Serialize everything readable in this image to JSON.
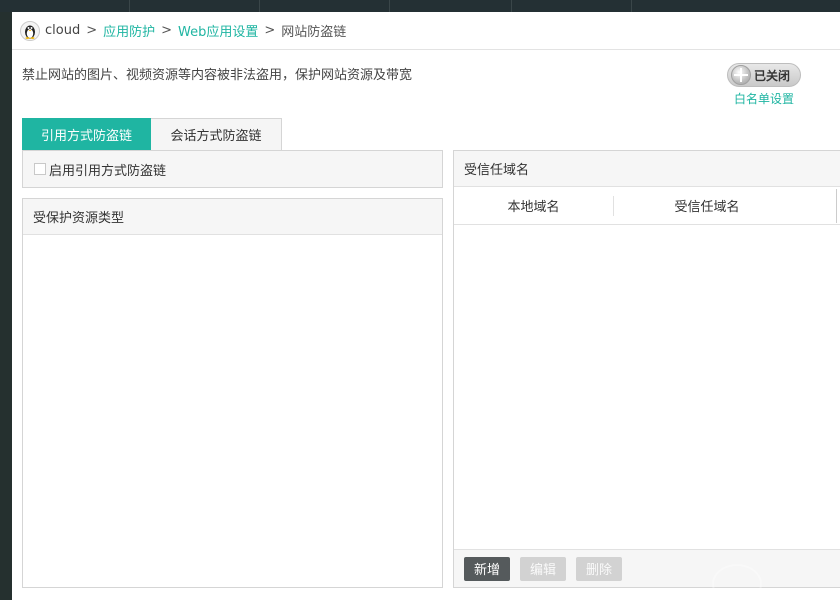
{
  "breadcrumb": {
    "root": "cloud",
    "level1": "应用防护",
    "level2": "Web应用设置",
    "current": "网站防盗链",
    "separator": ">"
  },
  "header": {
    "description": "禁止网站的图片、视频资源等内容被非法盗用，保护网站资源及带宽",
    "toggle_label": "已关闭",
    "whitelist_link": "白名单设置"
  },
  "tabs": [
    {
      "label": "引用方式防盗链",
      "active": true
    },
    {
      "label": "会话方式防盗链",
      "active": false
    }
  ],
  "enable": {
    "label": "启用引用方式防盗链",
    "checked": false
  },
  "resource_panel": {
    "title": "受保护资源类型"
  },
  "trust_panel": {
    "title": "受信任域名",
    "columns": [
      "本地域名",
      "受信任域名"
    ],
    "buttons": {
      "add": "新增",
      "edit": "编辑",
      "delete": "删除"
    }
  },
  "colors": {
    "accent": "#1fb5a2",
    "dark_button": "#555a5c",
    "disabled_button": "#d2d2d2"
  }
}
